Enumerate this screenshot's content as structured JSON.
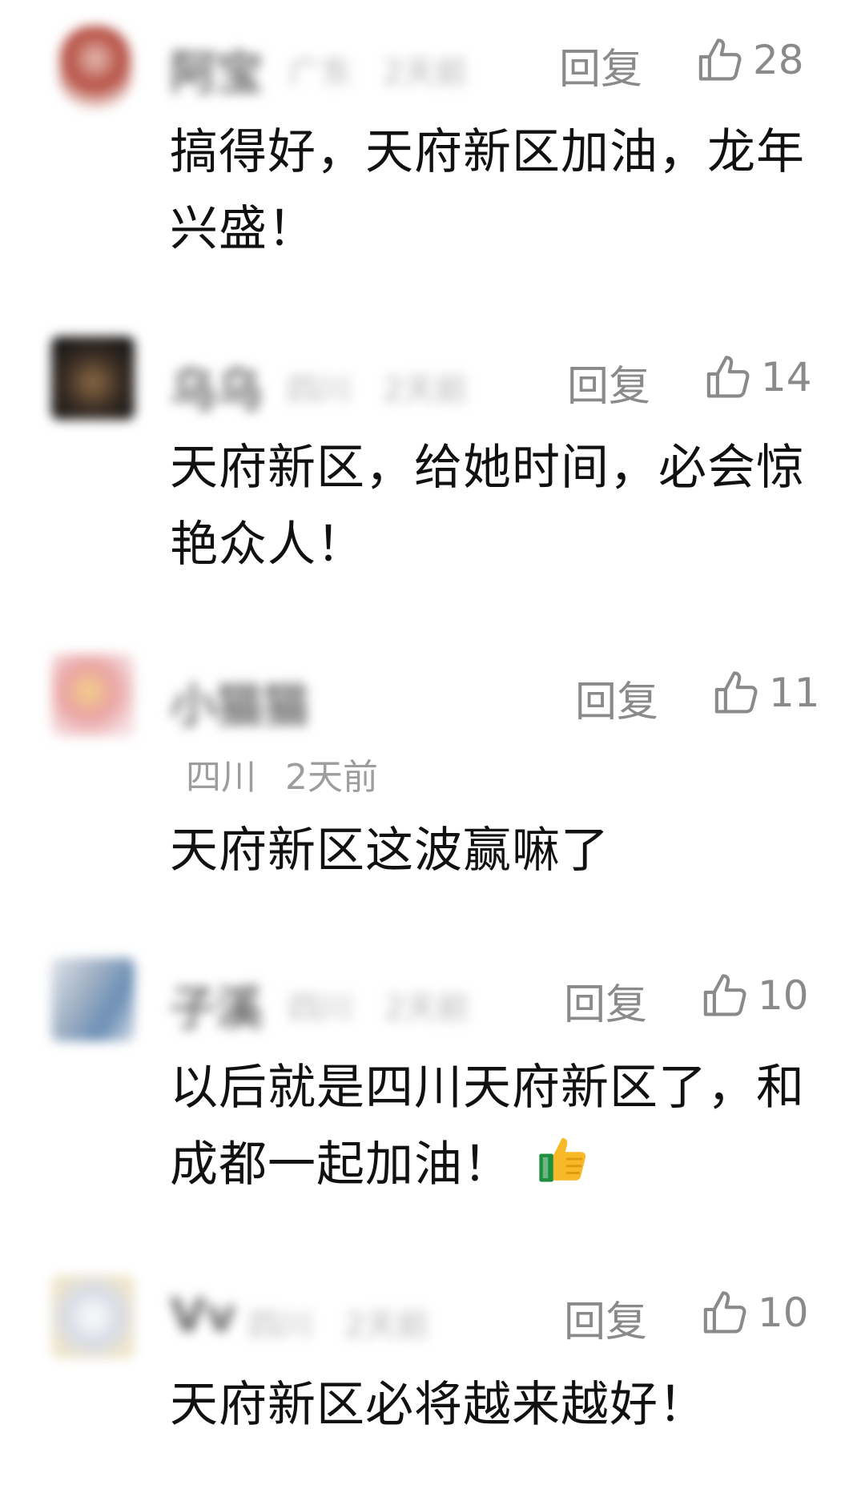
{
  "ui": {
    "reply_label": "回复",
    "like_icon": "thumbs-up-outline-icon"
  },
  "comments": [
    {
      "avatar": "avatar-blurred",
      "name": "阿宝",
      "location": "广东",
      "time": "2天前",
      "likes": "28",
      "text": "搞得好，天府新区加油，龙年兴盛！"
    },
    {
      "avatar": "avatar-blurred",
      "name": "乌乌",
      "location": "四川",
      "time": "2天前",
      "likes": "14",
      "text": "天府新区，给她时间，必会惊艳众人！"
    },
    {
      "avatar": "avatar-blurred",
      "name": "小猫猫",
      "location": "四川",
      "time": "2天前",
      "likes": "11",
      "text": "天府新区这波赢嘛了"
    },
    {
      "avatar": "avatar-blurred",
      "name": "子溪",
      "location": "四川",
      "time": "2天前",
      "likes": "10",
      "text": "以后就是四川天府新区了，和成都一起加油！",
      "emoji": "thumbs-up-emoji"
    },
    {
      "avatar": "avatar-blurred",
      "name": "Vv",
      "location": "四川",
      "time": "2天前",
      "likes": "10",
      "text": "天府新区必将越来越好！"
    }
  ]
}
